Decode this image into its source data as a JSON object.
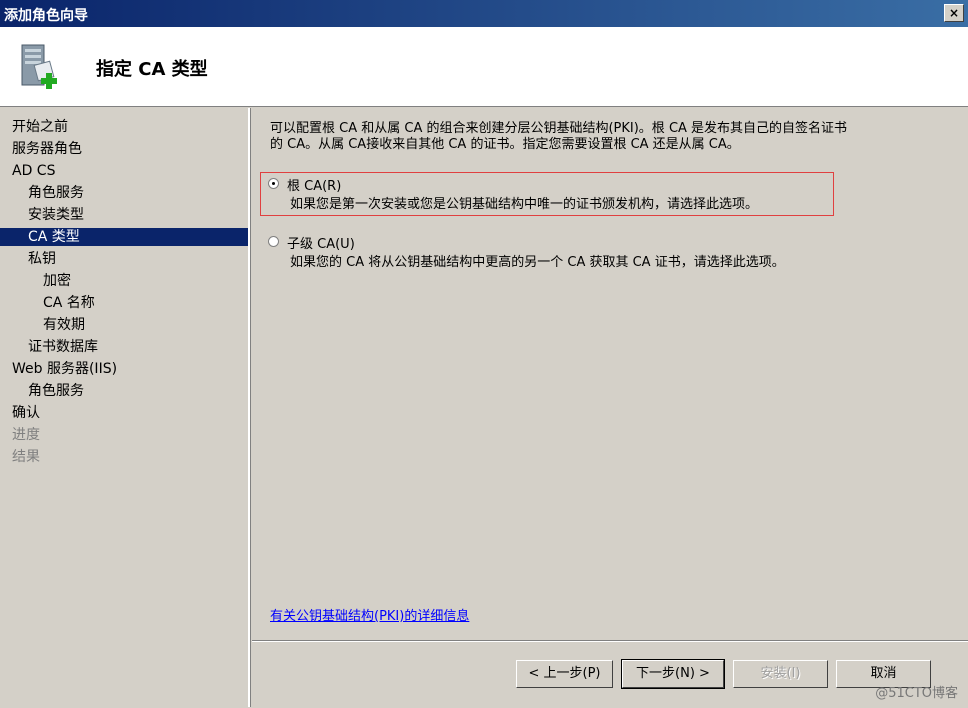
{
  "window": {
    "title": "添加角色向导",
    "close_label": "×"
  },
  "header": {
    "title": "指定 CA 类型",
    "icon": "server-add-icon"
  },
  "sidebar": {
    "items": [
      {
        "label": "开始之前",
        "level": 0,
        "state": "normal"
      },
      {
        "label": "服务器角色",
        "level": 0,
        "state": "normal"
      },
      {
        "label": "AD CS",
        "level": 0,
        "state": "normal"
      },
      {
        "label": "角色服务",
        "level": 1,
        "state": "normal"
      },
      {
        "label": "安装类型",
        "level": 1,
        "state": "normal"
      },
      {
        "label": "CA 类型",
        "level": 1,
        "state": "selected"
      },
      {
        "label": "私钥",
        "level": 1,
        "state": "normal"
      },
      {
        "label": "加密",
        "level": 2,
        "state": "normal"
      },
      {
        "label": "CA 名称",
        "level": 2,
        "state": "normal"
      },
      {
        "label": "有效期",
        "level": 2,
        "state": "normal"
      },
      {
        "label": "证书数据库",
        "level": 1,
        "state": "normal"
      },
      {
        "label": "Web 服务器(IIS)",
        "level": 0,
        "state": "normal"
      },
      {
        "label": "角色服务",
        "level": 1,
        "state": "normal"
      },
      {
        "label": "确认",
        "level": 0,
        "state": "normal"
      },
      {
        "label": "进度",
        "level": 0,
        "state": "disabled"
      },
      {
        "label": "结果",
        "level": 0,
        "state": "disabled"
      }
    ]
  },
  "main": {
    "description_line1": "可以配置根 CA 和从属 CA 的组合来创建分层公钥基础结构(PKI)。根 CA 是发布其自己的自签名证书",
    "description_line2": "的 CA。从属 CA接收来自其他 CA 的证书。指定您需要设置根 CA 还是从属 CA。",
    "options": [
      {
        "label": "根 CA(R)",
        "description": "如果您是第一次安装或您是公钥基础结构中唯一的证书颁发机构，请选择此选项。",
        "checked": true
      },
      {
        "label": "子级 CA(U)",
        "description": "如果您的 CA 将从公钥基础结构中更高的另一个 CA 获取其 CA 证书，请选择此选项。",
        "checked": false
      }
    ],
    "help_link": "有关公钥基础结构(PKI)的详细信息"
  },
  "footer": {
    "back_label": "< 上一步(P)",
    "next_label": "下一步(N) >",
    "install_label": "安装(I)",
    "cancel_label": "取消"
  },
  "watermark": "@51CTO博客"
}
